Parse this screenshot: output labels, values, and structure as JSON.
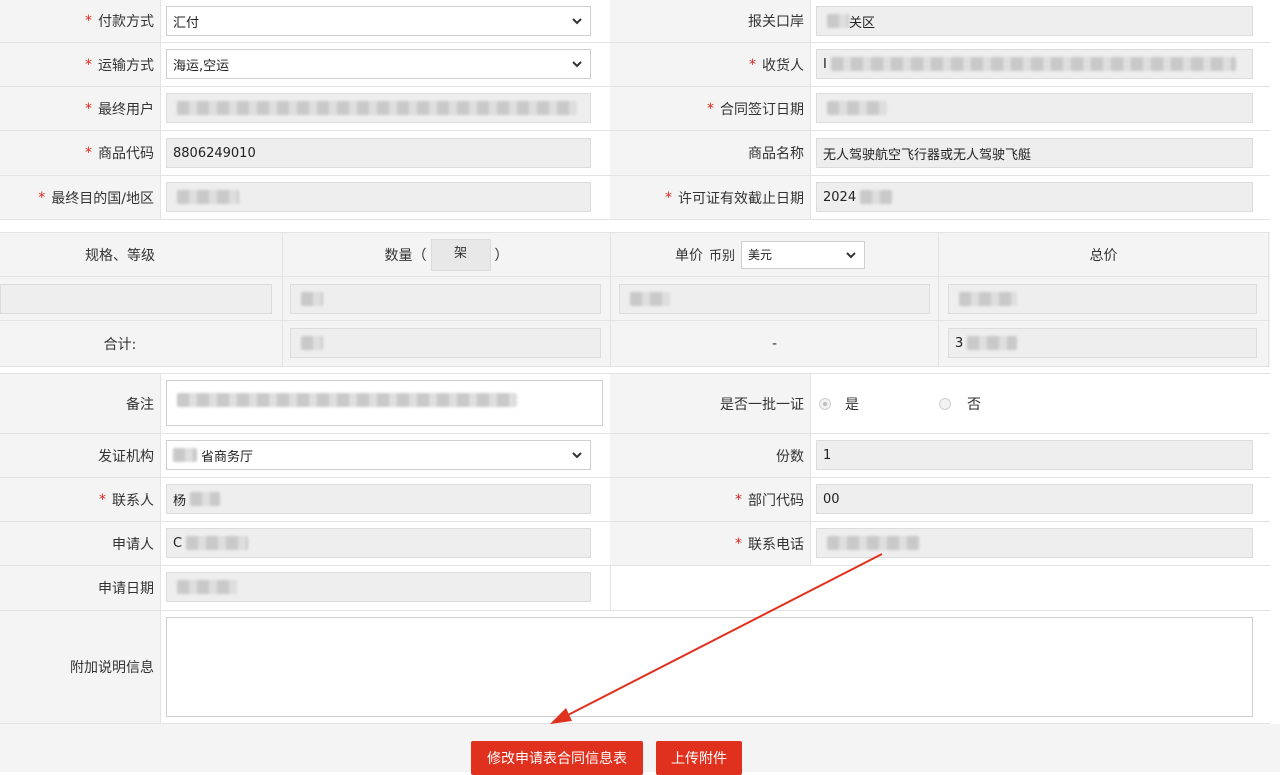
{
  "form": {
    "payment_method": {
      "label": "付款方式",
      "value": "汇付"
    },
    "customs_port": {
      "label": "报关口岸",
      "value": "关区"
    },
    "transport_method": {
      "label": "运输方式",
      "value": "海运,空运"
    },
    "consignee": {
      "label": "收货人",
      "value": "I"
    },
    "end_user": {
      "label": "最终用户",
      "value": ""
    },
    "contract_date": {
      "label": "合同签订日期",
      "value": ""
    },
    "goods_code": {
      "label": "商品代码",
      "value": "8806249010"
    },
    "goods_name": {
      "label": "商品名称",
      "value": "无人驾驶航空飞行器或无人驾驶飞艇"
    },
    "destination": {
      "label": "最终目的国/地区",
      "value": ""
    },
    "license_expiry": {
      "label": "许可证有效截止日期",
      "value": "2024"
    }
  },
  "goods_table": {
    "col_spec": "规格、等级",
    "col_qty": "数量（",
    "qty_unit": "架",
    "col_qty_close": "）",
    "col_price": "单价",
    "currency_label": "币别",
    "currency_value": "美元",
    "col_total": "总价",
    "total_label": "合计:",
    "dash": "-",
    "total_value": "3"
  },
  "form2": {
    "remarks_label": "备注",
    "one_batch_label": "是否一批一证",
    "yes": "是",
    "no": "否",
    "issuing_authority": {
      "label": "发证机构",
      "value": "省商务厅"
    },
    "copies": {
      "label": "份数",
      "value": "1"
    },
    "contact": {
      "label": "联系人",
      "value": "杨"
    },
    "dept_code": {
      "label": "部门代码",
      "value": "00"
    },
    "applicant": {
      "label": "申请人",
      "value": "C"
    },
    "phone": {
      "label": "联系电话",
      "value": ""
    },
    "apply_date": {
      "label": "申请日期",
      "value": ""
    },
    "extra_info_label": "附加说明信息"
  },
  "buttons": {
    "modify": "修改申请表合同信息表",
    "upload": "上传附件"
  },
  "colors": {
    "required": "#e2231a",
    "button": "#e0301e",
    "annotation_arrow": "#e0301e"
  }
}
